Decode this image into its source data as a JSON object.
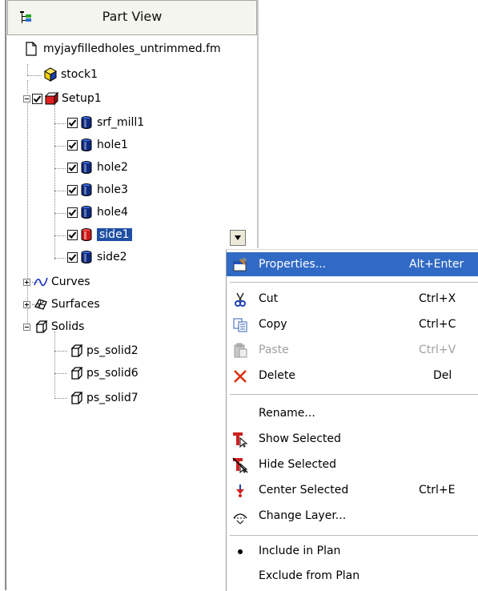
{
  "panel": {
    "title": "Part View",
    "file": "myjayfilledholes_untrimmed.fm",
    "stock": "stock1",
    "setup": "Setup1",
    "setup_items": [
      "srf_mill1",
      "hole1",
      "hole2",
      "hole3",
      "hole4",
      "side1",
      "side2"
    ],
    "selected_item": "side1",
    "curves": "Curves",
    "surfaces": "Surfaces",
    "solids": "Solids",
    "solid_items": [
      "ps_solid2",
      "ps_solid6",
      "ps_solid7"
    ]
  },
  "menu": {
    "properties": {
      "label": "Properties...",
      "shortcut": "Alt+Enter"
    },
    "cut": {
      "label": "Cut",
      "shortcut": "Ctrl+X"
    },
    "copy": {
      "label": "Copy",
      "shortcut": "Ctrl+C"
    },
    "paste": {
      "label": "Paste",
      "shortcut": "Ctrl+V"
    },
    "delete": {
      "label": "Delete",
      "shortcut": "Del"
    },
    "rename": {
      "label": "Rename..."
    },
    "show_selected": {
      "label": "Show Selected"
    },
    "hide_selected": {
      "label": "Hide Selected"
    },
    "center_selected": {
      "label": "Center Selected",
      "shortcut": "Ctrl+E"
    },
    "change_layer": {
      "label": "Change Layer..."
    },
    "include_in_plan": {
      "label": "Include in Plan"
    },
    "exclude_from_plan": {
      "label": "Exclude from Plan"
    }
  },
  "colors": {
    "selection": "#1f4fa4",
    "menu_highlight": "#316ac5",
    "disabled": "#a0a0a0"
  }
}
